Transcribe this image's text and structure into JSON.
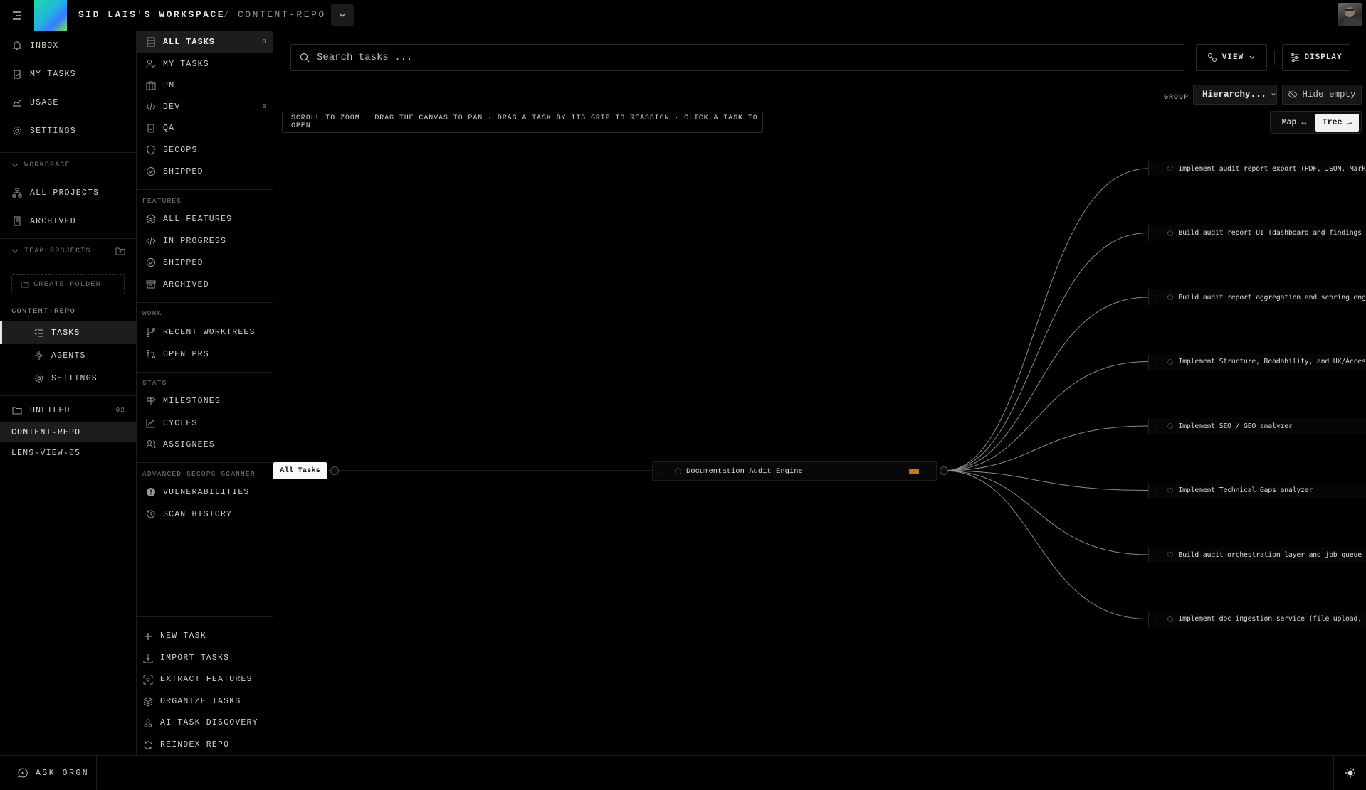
{
  "topbar": {
    "workspace_title": "SID LAIS'S WORKSPACE",
    "separator": "/",
    "repo_title": "CONTENT-REPO"
  },
  "sidebar": {
    "top_items": [
      {
        "label": "INBOX",
        "icon": "bell-icon"
      },
      {
        "label": "MY TASKS",
        "icon": "clipboard-icon"
      },
      {
        "label": "USAGE",
        "icon": "chart-icon"
      },
      {
        "label": "SETTINGS",
        "icon": "gear-icon"
      }
    ],
    "workspace_section": "WORKSPACE",
    "workspace_items": [
      {
        "label": "ALL PROJECTS",
        "icon": "hierarchy-icon"
      },
      {
        "label": "ARCHIVED",
        "icon": "archive-icon"
      }
    ],
    "team_section": "TEAM PROJECTS",
    "create_folder": "CREATE FOLDER",
    "project_label": "CONTENT-REPO",
    "project_sub": [
      {
        "label": "TASKS",
        "icon": "list-icon",
        "active": true
      },
      {
        "label": "AGENTS",
        "icon": "agents-icon"
      },
      {
        "label": "SETTINGS",
        "icon": "gear-icon"
      }
    ],
    "unfiled": {
      "label": "UNFILED",
      "count": "02"
    },
    "repos": [
      "CONTENT-REPO",
      "LENS-VIEW-05"
    ]
  },
  "panel": {
    "tasks": [
      {
        "label": "ALL TASKS",
        "count": "9",
        "active": true
      },
      {
        "label": "MY TASKS"
      },
      {
        "label": "PM"
      },
      {
        "label": "DEV",
        "count": "9"
      },
      {
        "label": "QA"
      },
      {
        "label": "SECOPS"
      },
      {
        "label": "SHIPPED"
      }
    ],
    "features_section": "FEATURES",
    "features": [
      "ALL FEATURES",
      "IN PROGRESS",
      "SHIPPED",
      "ARCHIVED"
    ],
    "work_section": "WORK",
    "work": [
      "RECENT WORKTREES",
      "OPEN PRS"
    ],
    "stats_section": "STATS",
    "stats": [
      "MILESTONES",
      "CYCLES",
      "ASSIGNEES"
    ],
    "secops_section": "ADVANCED SECOPS SCANNER",
    "secops": [
      "VULNERABILITIES",
      "SCAN HISTORY"
    ],
    "actions": [
      "NEW TASK",
      "IMPORT TASKS",
      "EXTRACT FEATURES",
      "ORGANIZE TASKS",
      "AI TASK DISCOVERY",
      "REINDEX REPO"
    ]
  },
  "main": {
    "search_placeholder": "Search tasks ...",
    "view_label": "VIEW",
    "display_label": "DISPLAY",
    "group_label": "GROUP",
    "group_value": "Hierarchy...",
    "hide_empty": "Hide empty",
    "hint": "SCROLL TO ZOOM · DRAG THE CANVAS TO PAN · DRAG A TASK BY ITS GRIP TO REASSIGN · CLICK A TASK TO OPEN",
    "map_label": "Map ↔",
    "tree_label": "Tree →"
  },
  "tree": {
    "root": "All Tasks",
    "epic": "Documentation Audit Engine",
    "tasks": [
      "Implement audit report export (PDF, JSON, Markdown)",
      "Build audit report UI (dashboard and findings view)",
      "Build audit report aggregation and scoring engine",
      "Implement Structure, Readability, and UX/Accessibility",
      "Implement SEO / GEO analyzer",
      "Implement Technical Gaps analyzer",
      "Build audit orchestration layer and job queue",
      "Implement doc ingestion service (file upload, paste, U"
    ]
  },
  "bottombar": {
    "ask_label": "ASK ORGN"
  }
}
